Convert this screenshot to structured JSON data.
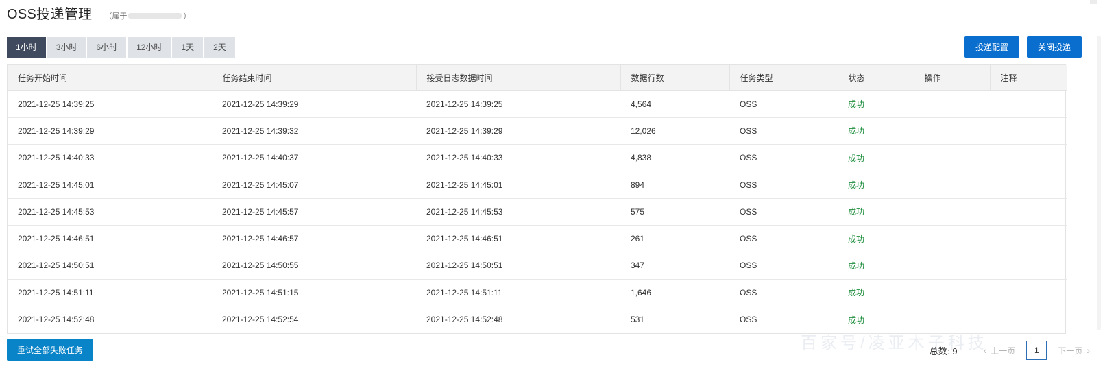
{
  "header": {
    "title": "OSS投递管理",
    "owner_prefix": "（属于",
    "owner_suffix": "）"
  },
  "time_ranges": [
    {
      "label": "1小时",
      "active": true
    },
    {
      "label": "3小时",
      "active": false
    },
    {
      "label": "6小时",
      "active": false
    },
    {
      "label": "12小时",
      "active": false
    },
    {
      "label": "1天",
      "active": false
    },
    {
      "label": "2天",
      "active": false
    }
  ],
  "actions": {
    "config_label": "投递配置",
    "close_label": "关闭投递"
  },
  "table": {
    "columns": [
      "任务开始时间",
      "任务结束时间",
      "接受日志数据时间",
      "数据行数",
      "任务类型",
      "状态",
      "操作",
      "注释"
    ],
    "rows": [
      {
        "start": "2021-12-25 14:39:25",
        "end": "2021-12-25 14:39:29",
        "received": "2021-12-25 14:39:25",
        "rows": "4,564",
        "type": "OSS",
        "status": "成功",
        "operation": "",
        "note": ""
      },
      {
        "start": "2021-12-25 14:39:29",
        "end": "2021-12-25 14:39:32",
        "received": "2021-12-25 14:39:29",
        "rows": "12,026",
        "type": "OSS",
        "status": "成功",
        "operation": "",
        "note": ""
      },
      {
        "start": "2021-12-25 14:40:33",
        "end": "2021-12-25 14:40:37",
        "received": "2021-12-25 14:40:33",
        "rows": "4,838",
        "type": "OSS",
        "status": "成功",
        "operation": "",
        "note": ""
      },
      {
        "start": "2021-12-25 14:45:01",
        "end": "2021-12-25 14:45:07",
        "received": "2021-12-25 14:45:01",
        "rows": "894",
        "type": "OSS",
        "status": "成功",
        "operation": "",
        "note": ""
      },
      {
        "start": "2021-12-25 14:45:53",
        "end": "2021-12-25 14:45:57",
        "received": "2021-12-25 14:45:53",
        "rows": "575",
        "type": "OSS",
        "status": "成功",
        "operation": "",
        "note": ""
      },
      {
        "start": "2021-12-25 14:46:51",
        "end": "2021-12-25 14:46:57",
        "received": "2021-12-25 14:46:51",
        "rows": "261",
        "type": "OSS",
        "status": "成功",
        "operation": "",
        "note": ""
      },
      {
        "start": "2021-12-25 14:50:51",
        "end": "2021-12-25 14:50:55",
        "received": "2021-12-25 14:50:51",
        "rows": "347",
        "type": "OSS",
        "status": "成功",
        "operation": "",
        "note": ""
      },
      {
        "start": "2021-12-25 14:51:11",
        "end": "2021-12-25 14:51:15",
        "received": "2021-12-25 14:51:11",
        "rows": "1,646",
        "type": "OSS",
        "status": "成功",
        "operation": "",
        "note": ""
      },
      {
        "start": "2021-12-25 14:52:48",
        "end": "2021-12-25 14:52:54",
        "received": "2021-12-25 14:52:48",
        "rows": "531",
        "type": "OSS",
        "status": "成功",
        "operation": "",
        "note": ""
      }
    ]
  },
  "footer": {
    "retry_label": "重试全部失败任务",
    "total_label": "总数:",
    "total_value": "9",
    "prev_label": "上一页",
    "next_label": "下一页",
    "current_page": "1"
  },
  "colors": {
    "primary": "#0a6ecf",
    "active_tab": "#3f4a5e",
    "success": "#1e8e3e"
  },
  "icons": {
    "prev": "chevron-left-icon",
    "next": "chevron-right-icon"
  }
}
